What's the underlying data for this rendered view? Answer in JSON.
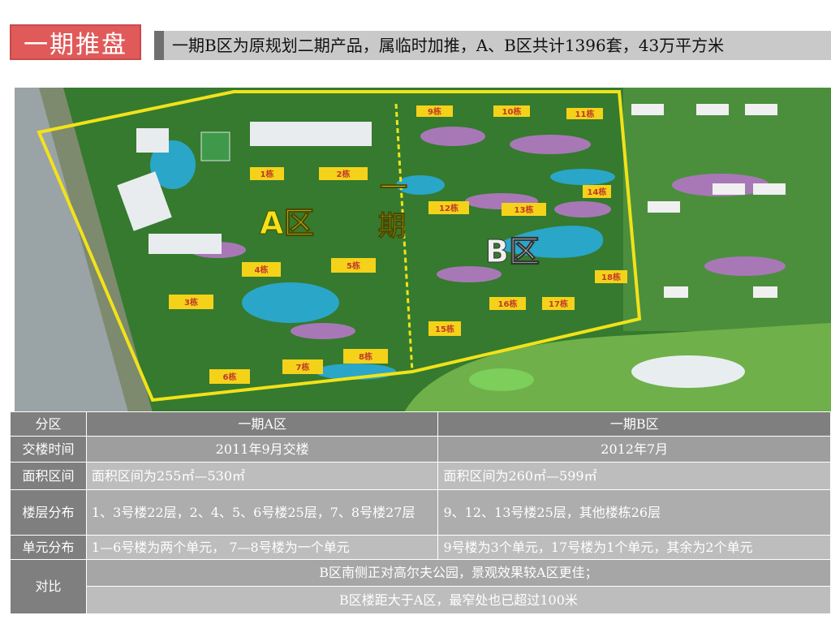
{
  "header": {
    "title": "一期推盘",
    "subtitle": "一期B区为原规划二期产品，属临时加推，A、B区共计1396套，43万平方米"
  },
  "map": {
    "zone_a_label": "A区",
    "zone_b_label": "B区",
    "phase_label_top": "一",
    "phase_label_bottom": "期",
    "buildings": [
      {
        "label": "1栋"
      },
      {
        "label": "2栋"
      },
      {
        "label": "3栋"
      },
      {
        "label": "4栋"
      },
      {
        "label": "5栋"
      },
      {
        "label": "6栋"
      },
      {
        "label": "7栋"
      },
      {
        "label": "8栋"
      },
      {
        "label": "9栋"
      },
      {
        "label": "10栋"
      },
      {
        "label": "11栋"
      },
      {
        "label": "12栋"
      },
      {
        "label": "13栋"
      },
      {
        "label": "14栋"
      },
      {
        "label": "15栋"
      },
      {
        "label": "16栋"
      },
      {
        "label": "17栋"
      },
      {
        "label": "18栋"
      }
    ],
    "colors": {
      "boundary": "#f2e21a",
      "building": "#f5d21a",
      "water": "#2aa6c8",
      "grass": "#3f8a34",
      "flower": "#b07ab8"
    }
  },
  "table": {
    "header": {
      "col1": "分区",
      "col2": "一期A区",
      "col3": "一期B区"
    },
    "rows": [
      {
        "label": "交楼时间",
        "a": "2011年9月交楼",
        "b": "2012年7月"
      },
      {
        "label": "面积区间",
        "a": "面积区间为255㎡—530㎡",
        "b": "面积区间为260㎡—599㎡"
      },
      {
        "label": "楼层分布",
        "a": "1、3号楼22层，2、4、5、6号楼25层，7、8号楼27层",
        "b": "9、12、13号楼25层，其他楼栋26层"
      },
      {
        "label": "单元分布",
        "a": "1—6号楼为两个单元，  7—8号楼为一个单元",
        "b": "9号楼为3个单元，17号楼为1个单元，其余为2个单元"
      }
    ],
    "compare": {
      "label": "对比",
      "line1": "B区南侧正对高尔夫公园，景观效果较A区更佳；",
      "line2": "B区楼距大于A区，最窄处也已超过100米"
    }
  }
}
